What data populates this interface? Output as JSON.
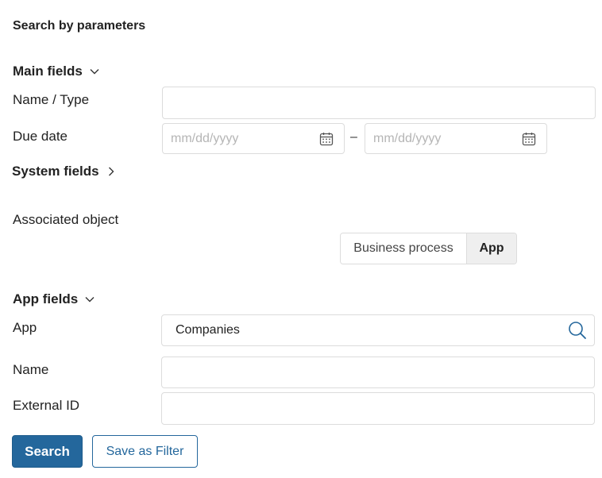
{
  "panel": {
    "title": "Search by parameters"
  },
  "main_fields": {
    "header": "Main fields",
    "name_type_label": "Name / Type",
    "name_type_value": "",
    "due_date_label": "Due date",
    "date_from_placeholder": "mm/dd/yyyy",
    "date_separator": "–",
    "date_to_placeholder": "mm/dd/yyyy"
  },
  "system_fields": {
    "header": "System fields"
  },
  "associated_object": {
    "label": "Associated object",
    "options": [
      "Business process",
      "App"
    ],
    "selected": "App"
  },
  "app_fields": {
    "header": "App fields",
    "app_label": "App",
    "app_value": "Companies",
    "name_label": "Name",
    "name_value": "",
    "external_id_label": "External ID",
    "external_id_value": ""
  },
  "actions": {
    "search_label": "Search",
    "save_filter_label": "Save as Filter"
  },
  "icons": {
    "main_fields_toggle": "chevron-down-icon",
    "system_fields_toggle": "chevron-right-icon",
    "app_fields_toggle": "chevron-down-icon",
    "date_picker": "calendar-icon",
    "app_lookup": "search-icon"
  },
  "colors": {
    "primary": "#24679c",
    "border": "#dcdcdc",
    "selected_segment_bg": "#efefef",
    "placeholder": "#b5b5b5"
  }
}
